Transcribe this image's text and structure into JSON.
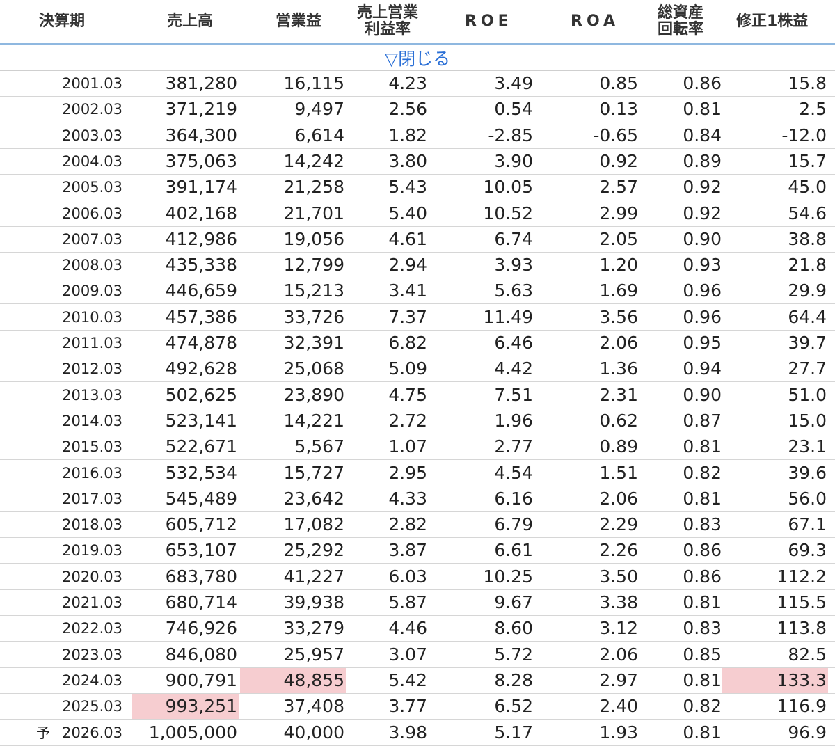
{
  "header": {
    "period": "決算期",
    "sales": "売上高",
    "op_income": "営業益",
    "op_margin_line1": "売上営業",
    "op_margin_line2": "利益率",
    "roe": "ROE",
    "roa": "ROA",
    "turnover_line1": "総資産",
    "turnover_line2": "回転率",
    "eps": "修正1株益"
  },
  "toggle_label": "▽閉じる",
  "forecast_marker": "予",
  "highlight_color": "#f6cdd0",
  "link_color": "#2a6fd6",
  "rows": [
    {
      "period": "2001.03",
      "sales": "381,280",
      "op": "16,115",
      "margin": "4.23",
      "roe": "3.49",
      "roa": "0.85",
      "turnover": "0.86",
      "eps": "15.8"
    },
    {
      "period": "2002.03",
      "sales": "371,219",
      "op": "9,497",
      "margin": "2.56",
      "roe": "0.54",
      "roa": "0.13",
      "turnover": "0.81",
      "eps": "2.5"
    },
    {
      "period": "2003.03",
      "sales": "364,300",
      "op": "6,614",
      "margin": "1.82",
      "roe": "-2.85",
      "roa": "-0.65",
      "turnover": "0.84",
      "eps": "-12.0"
    },
    {
      "period": "2004.03",
      "sales": "375,063",
      "op": "14,242",
      "margin": "3.80",
      "roe": "3.90",
      "roa": "0.92",
      "turnover": "0.89",
      "eps": "15.7"
    },
    {
      "period": "2005.03",
      "sales": "391,174",
      "op": "21,258",
      "margin": "5.43",
      "roe": "10.05",
      "roa": "2.57",
      "turnover": "0.92",
      "eps": "45.0"
    },
    {
      "period": "2006.03",
      "sales": "402,168",
      "op": "21,701",
      "margin": "5.40",
      "roe": "10.52",
      "roa": "2.99",
      "turnover": "0.92",
      "eps": "54.6"
    },
    {
      "period": "2007.03",
      "sales": "412,986",
      "op": "19,056",
      "margin": "4.61",
      "roe": "6.74",
      "roa": "2.05",
      "turnover": "0.90",
      "eps": "38.8"
    },
    {
      "period": "2008.03",
      "sales": "435,338",
      "op": "12,799",
      "margin": "2.94",
      "roe": "3.93",
      "roa": "1.20",
      "turnover": "0.93",
      "eps": "21.8"
    },
    {
      "period": "2009.03",
      "sales": "446,659",
      "op": "15,213",
      "margin": "3.41",
      "roe": "5.63",
      "roa": "1.69",
      "turnover": "0.96",
      "eps": "29.9"
    },
    {
      "period": "2010.03",
      "sales": "457,386",
      "op": "33,726",
      "margin": "7.37",
      "roe": "11.49",
      "roa": "3.56",
      "turnover": "0.96",
      "eps": "64.4"
    },
    {
      "period": "2011.03",
      "sales": "474,878",
      "op": "32,391",
      "margin": "6.82",
      "roe": "6.46",
      "roa": "2.06",
      "turnover": "0.95",
      "eps": "39.7"
    },
    {
      "period": "2012.03",
      "sales": "492,628",
      "op": "25,068",
      "margin": "5.09",
      "roe": "4.42",
      "roa": "1.36",
      "turnover": "0.94",
      "eps": "27.7"
    },
    {
      "period": "2013.03",
      "sales": "502,625",
      "op": "23,890",
      "margin": "4.75",
      "roe": "7.51",
      "roa": "2.31",
      "turnover": "0.90",
      "eps": "51.0"
    },
    {
      "period": "2014.03",
      "sales": "523,141",
      "op": "14,221",
      "margin": "2.72",
      "roe": "1.96",
      "roa": "0.62",
      "turnover": "0.87",
      "eps": "15.0"
    },
    {
      "period": "2015.03",
      "sales": "522,671",
      "op": "5,567",
      "margin": "1.07",
      "roe": "2.77",
      "roa": "0.89",
      "turnover": "0.81",
      "eps": "23.1"
    },
    {
      "period": "2016.03",
      "sales": "532,534",
      "op": "15,727",
      "margin": "2.95",
      "roe": "4.54",
      "roa": "1.51",
      "turnover": "0.82",
      "eps": "39.6"
    },
    {
      "period": "2017.03",
      "sales": "545,489",
      "op": "23,642",
      "margin": "4.33",
      "roe": "6.16",
      "roa": "2.06",
      "turnover": "0.81",
      "eps": "56.0"
    },
    {
      "period": "2018.03",
      "sales": "605,712",
      "op": "17,082",
      "margin": "2.82",
      "roe": "6.79",
      "roa": "2.29",
      "turnover": "0.83",
      "eps": "67.1"
    },
    {
      "period": "2019.03",
      "sales": "653,107",
      "op": "25,292",
      "margin": "3.87",
      "roe": "6.61",
      "roa": "2.26",
      "turnover": "0.86",
      "eps": "69.3"
    },
    {
      "period": "2020.03",
      "sales": "683,780",
      "op": "41,227",
      "margin": "6.03",
      "roe": "10.25",
      "roa": "3.50",
      "turnover": "0.86",
      "eps": "112.2"
    },
    {
      "period": "2021.03",
      "sales": "680,714",
      "op": "39,938",
      "margin": "5.87",
      "roe": "9.67",
      "roa": "3.38",
      "turnover": "0.81",
      "eps": "115.5"
    },
    {
      "period": "2022.03",
      "sales": "746,926",
      "op": "33,279",
      "margin": "4.46",
      "roe": "8.60",
      "roa": "3.12",
      "turnover": "0.83",
      "eps": "113.8"
    },
    {
      "period": "2023.03",
      "sales": "846,080",
      "op": "25,957",
      "margin": "3.07",
      "roe": "5.72",
      "roa": "2.06",
      "turnover": "0.85",
      "eps": "82.5"
    },
    {
      "period": "2024.03",
      "sales": "900,791",
      "op": "48,855",
      "margin": "5.42",
      "roe": "8.28",
      "roa": "2.97",
      "turnover": "0.81",
      "eps": "133.3",
      "highlight": [
        "op",
        "eps"
      ]
    },
    {
      "period": "2025.03",
      "sales": "993,251",
      "op": "37,408",
      "margin": "3.77",
      "roe": "6.52",
      "roa": "2.40",
      "turnover": "0.82",
      "eps": "116.9",
      "highlight": [
        "sales"
      ]
    },
    {
      "period": "2026.03",
      "sales": "1,005,000",
      "op": "40,000",
      "margin": "3.98",
      "roe": "5.17",
      "roa": "1.93",
      "turnover": "0.81",
      "eps": "96.9",
      "forecast": true
    }
  ]
}
